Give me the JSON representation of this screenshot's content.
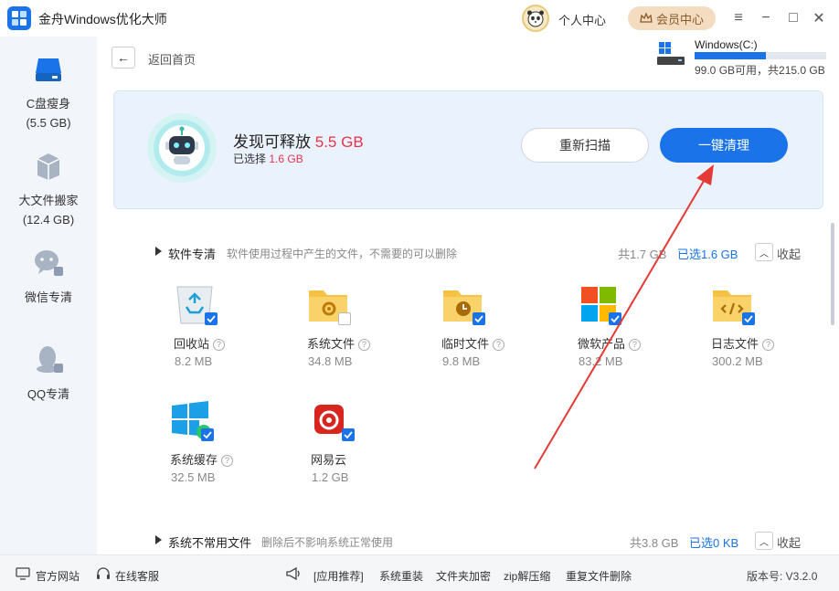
{
  "window": {
    "title": "金舟Windows优化大师",
    "personal_center": "个人中心",
    "vip_center": "会员中心",
    "controls": [
      "menu-icon",
      "minimize-icon",
      "maximize-icon",
      "close-icon"
    ]
  },
  "sidebar": {
    "items": [
      {
        "label": "C盘瘦身",
        "sub": "(5.5 GB)",
        "icon": "drive-icon"
      },
      {
        "label": "大文件搬家",
        "sub": "(12.4 GB)",
        "icon": "box-icon"
      },
      {
        "label": "微信专清",
        "sub": "",
        "icon": "wechat-icon"
      },
      {
        "label": "QQ专清",
        "sub": "",
        "icon": "qq-icon"
      }
    ]
  },
  "nav": {
    "back_label": "返回首页"
  },
  "drive": {
    "name": "Windows(C:)",
    "info": "99.0 GB可用，共215.0 GB",
    "used_fraction": 0.54
  },
  "banner": {
    "found_prefix": "发现可释放",
    "found_value": "5.5 GB",
    "selected_prefix": "已选择",
    "selected_value": "1.6 GB",
    "rescan": "重新扫描",
    "clean": "一键清理"
  },
  "sections": [
    {
      "title": "软件专清",
      "desc": "软件使用过程中产生的文件，不需要的可以删除",
      "total": "共1.7 GB",
      "selected": "已选1.6 GB",
      "collapse": "收起",
      "items": [
        {
          "name": "回收站",
          "size": "8.2 MB",
          "checked": true,
          "icon": "recycle-bin-icon",
          "help": true
        },
        {
          "name": "系统文件",
          "size": "34.8 MB",
          "checked": false,
          "icon": "system-folder-icon",
          "help": true
        },
        {
          "name": "临时文件",
          "size": "9.8 MB",
          "checked": true,
          "icon": "temp-folder-icon",
          "help": true
        },
        {
          "name": "微软产品",
          "size": "83.2 MB",
          "checked": true,
          "icon": "microsoft-icon",
          "help": true
        },
        {
          "name": "日志文件",
          "size": "300.2 MB",
          "checked": true,
          "icon": "log-folder-icon",
          "help": true
        },
        {
          "name": "系统缓存",
          "size": "32.5 MB",
          "checked": true,
          "icon": "windows-cache-icon",
          "help": true
        },
        {
          "name": "网易云",
          "size": "1.2 GB",
          "checked": true,
          "icon": "netease-music-icon",
          "help": false
        }
      ]
    },
    {
      "title": "系统不常用文件",
      "desc": "删除后不影响系统正常使用",
      "total": "共3.8 GB",
      "selected": "已选0 KB",
      "collapse": "收起"
    }
  ],
  "footer": {
    "official_site": "官方网站",
    "online_service": "在线客服",
    "app_recommend": "[应用推荐]",
    "links": [
      "系统重装",
      "文件夹加密",
      "zip解压缩",
      "重复文件删除"
    ],
    "version": "版本号: V3.2.0"
  },
  "colors": {
    "accent": "#1a73e8",
    "highlight": "#e5344a",
    "annotation_arrow": "#e53935"
  }
}
